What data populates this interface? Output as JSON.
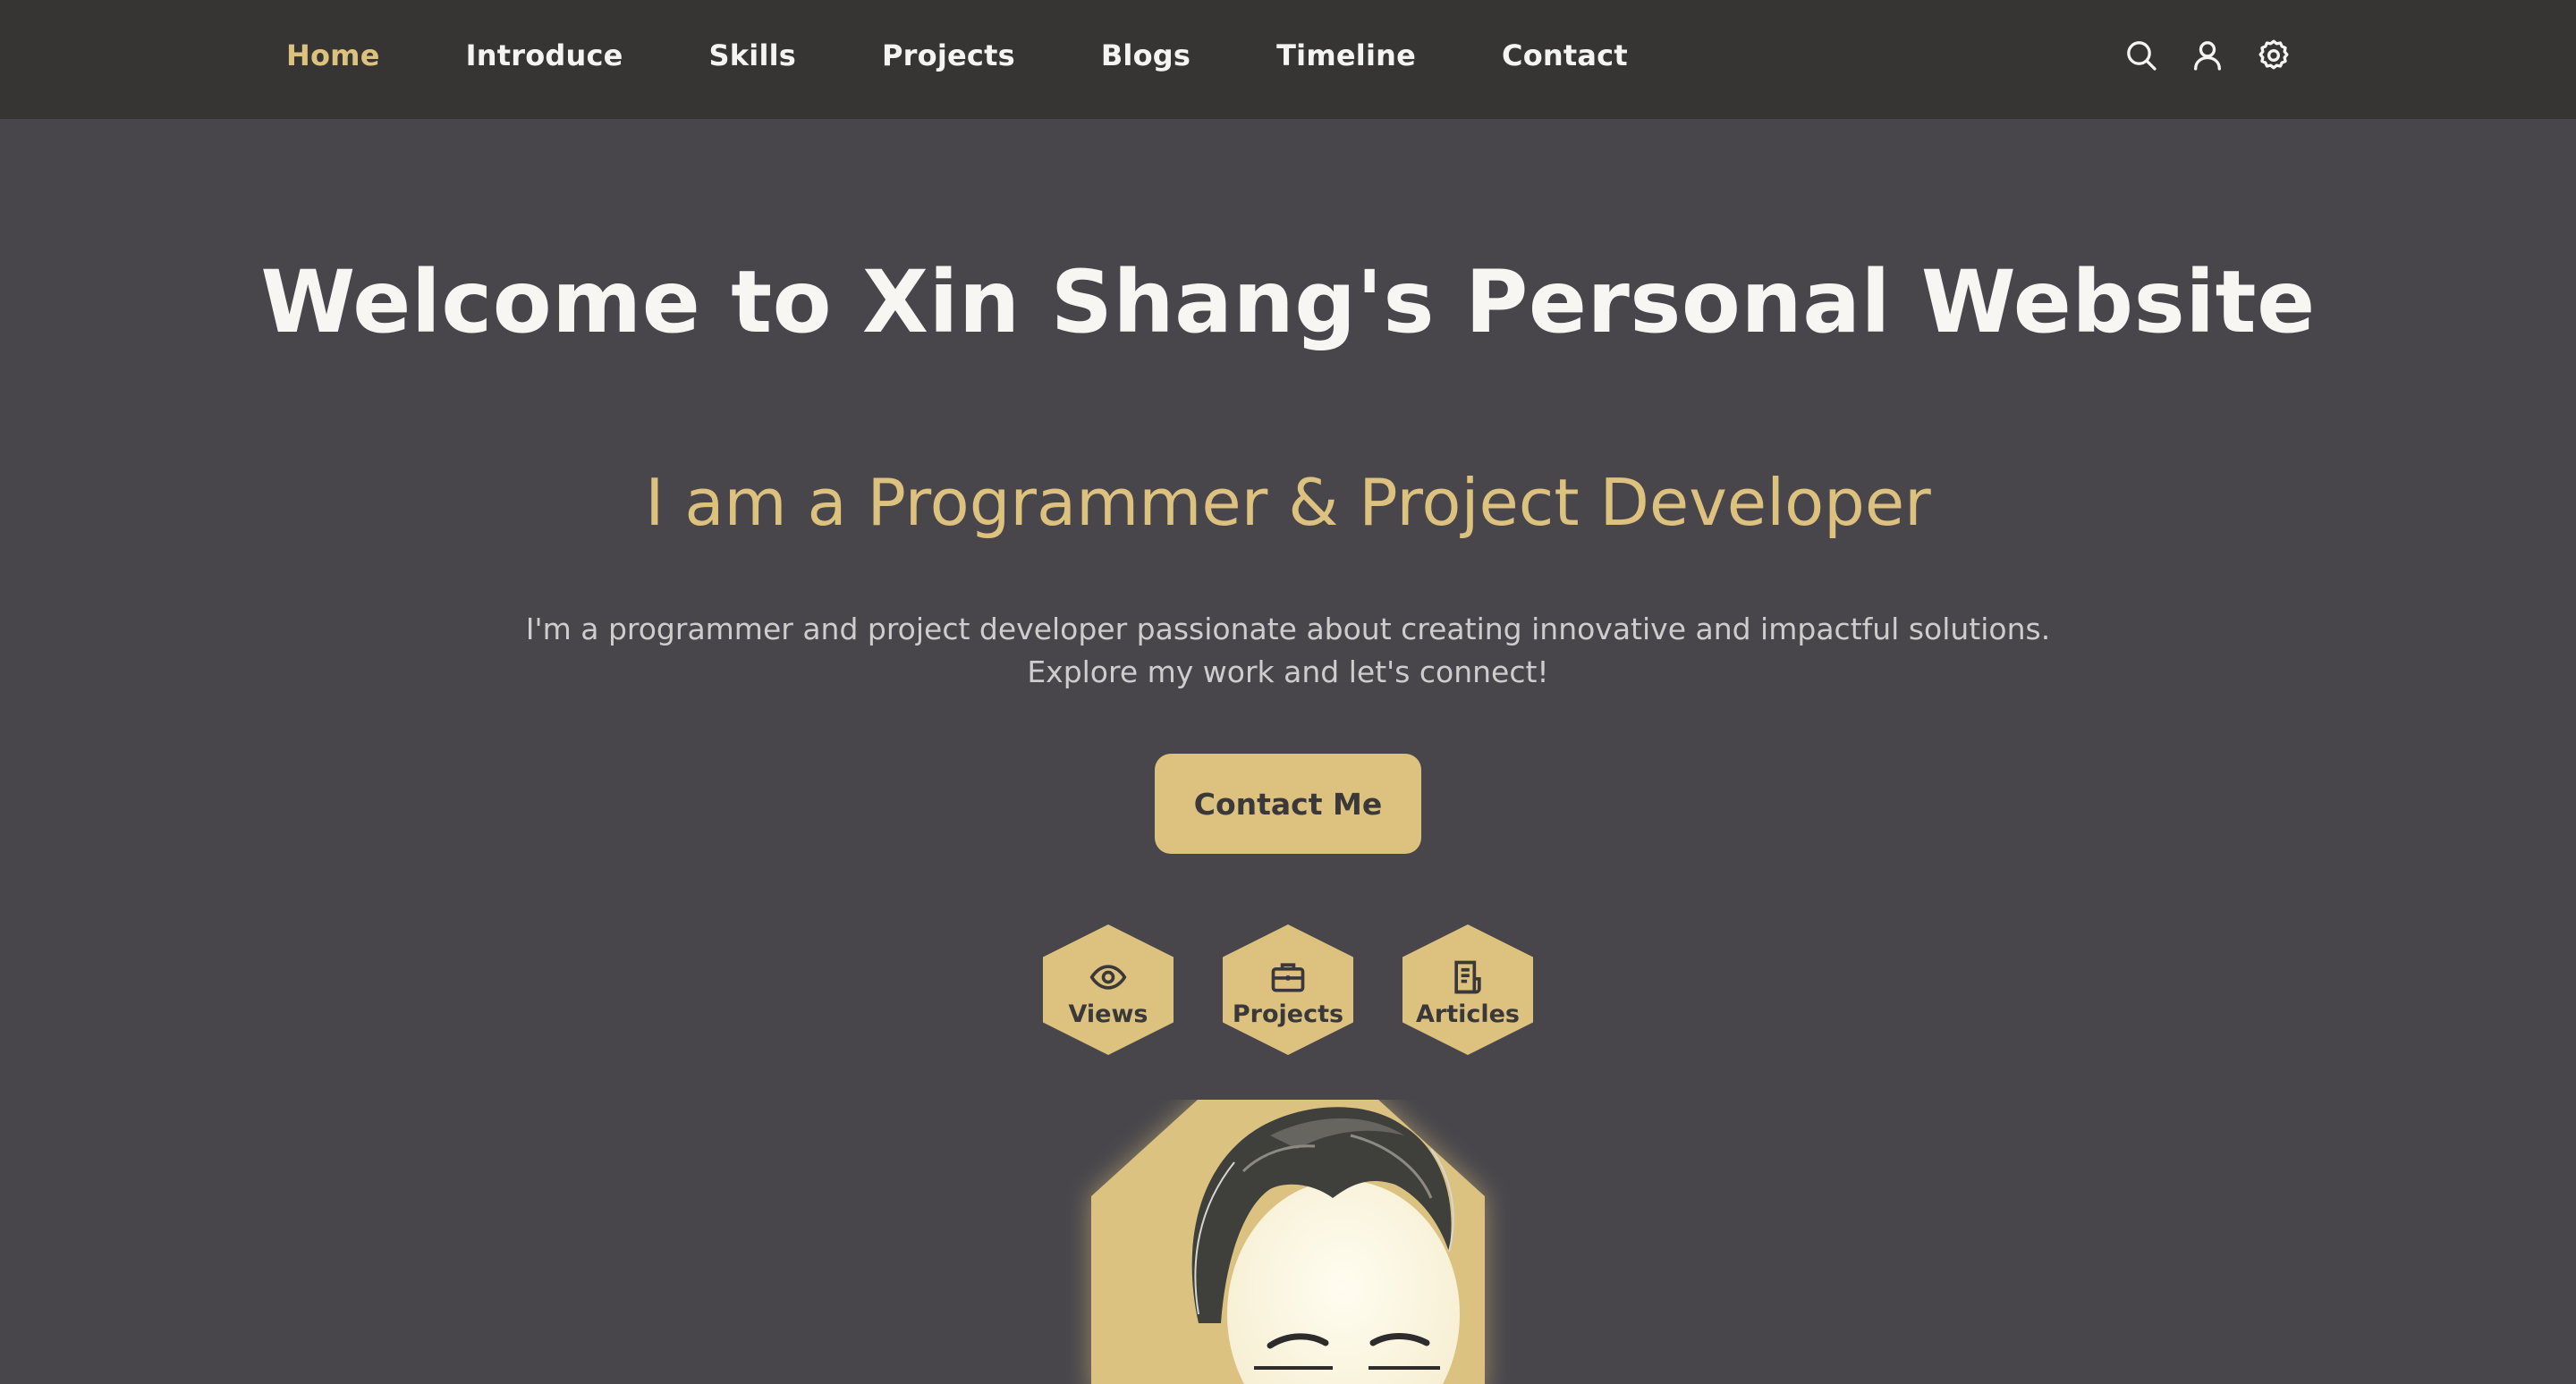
{
  "nav": {
    "links": [
      {
        "label": "Home",
        "active": true
      },
      {
        "label": "Introduce",
        "active": false
      },
      {
        "label": "Skills",
        "active": false
      },
      {
        "label": "Projects",
        "active": false
      },
      {
        "label": "Blogs",
        "active": false
      },
      {
        "label": "Timeline",
        "active": false
      },
      {
        "label": "Contact",
        "active": false
      }
    ],
    "tools": [
      "search-icon",
      "user-icon",
      "settings-gear-icon"
    ]
  },
  "hero": {
    "title": "Welcome to Xin Shang's Personal Website",
    "subtitle": "I am a Programmer & Project Developer",
    "description_line1": "I'm a programmer and project developer passionate about creating innovative and impactful solutions.",
    "description_line2": "Explore my work and let's connect!",
    "cta_label": "Contact Me"
  },
  "stats": [
    {
      "label": "Views",
      "icon": "eye-icon"
    },
    {
      "label": "Projects",
      "icon": "briefcase-icon"
    },
    {
      "label": "Articles",
      "icon": "document-icon"
    }
  ],
  "colors": {
    "accent": "#dcc17f",
    "navbar_bg": "#363533",
    "page_bg": "#48464b",
    "text_light": "#f7f6f3"
  }
}
